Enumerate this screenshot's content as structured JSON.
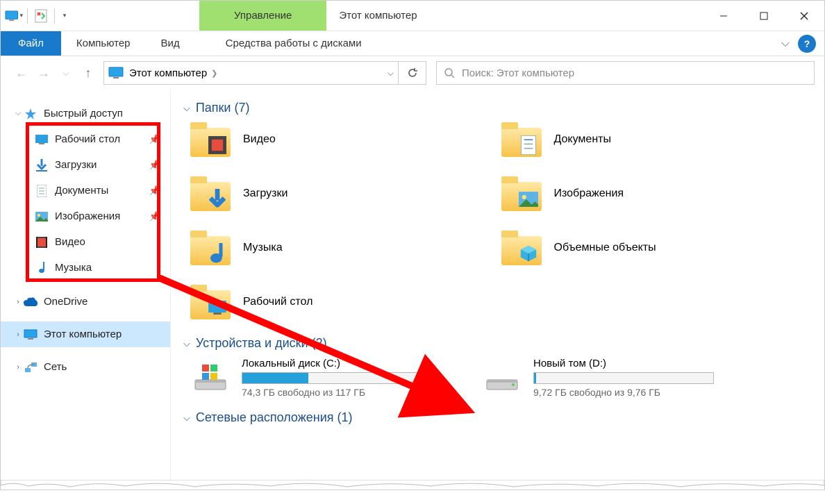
{
  "titlebar": {
    "contextual_tab": "Управление",
    "window_title": "Этот компьютер"
  },
  "ribbon": {
    "file": "Файл",
    "computer": "Компьютер",
    "view": "Вид",
    "drive_tools": "Средства работы с дисками"
  },
  "addressbar": {
    "location": "Этот компьютер",
    "search_placeholder": "Поиск: Этот компьютер"
  },
  "sidebar": {
    "quick_access": "Быстрый доступ",
    "desktop": "Рабочий стол",
    "downloads": "Загрузки",
    "documents": "Документы",
    "pictures": "Изображения",
    "videos": "Видео",
    "music": "Музыка",
    "onedrive": "OneDrive",
    "this_pc": "Этот компьютер",
    "network": "Сеть"
  },
  "content": {
    "folders_header": "Папки (7)",
    "videos": "Видео",
    "documents": "Документы",
    "downloads": "Загрузки",
    "pictures": "Изображения",
    "music": "Музыка",
    "objects3d": "Объемные объекты",
    "desktop": "Рабочий стол",
    "devices_header": "Устройства и диски (2)",
    "drive_c": {
      "name": "Локальный диск (C:)",
      "free_text": "74,3 ГБ свободно из 117 ГБ",
      "fill_percent": 37
    },
    "drive_d": {
      "name": "Новый том (D:)",
      "free_text": "9,72 ГБ свободно из 9,76 ГБ",
      "fill_percent": 1
    },
    "network_locations_header": "Сетевые расположения (1)"
  }
}
